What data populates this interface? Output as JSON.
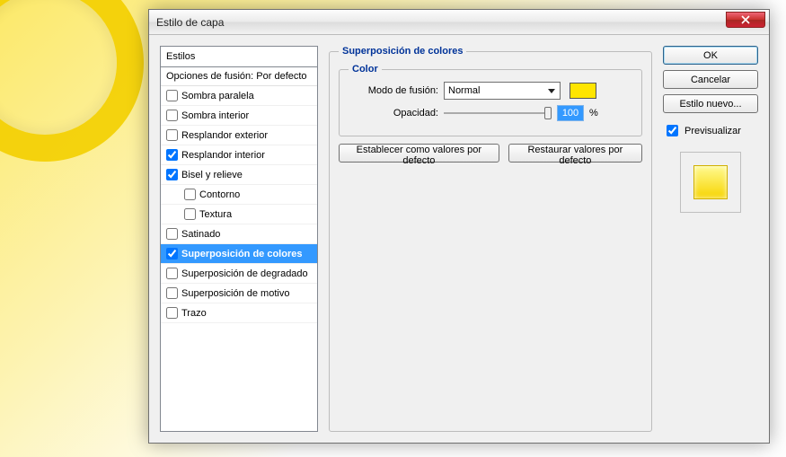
{
  "dialog": {
    "title": "Estilo de capa"
  },
  "styles_panel": {
    "header": "Estilos",
    "blend_options": "Opciones de fusión: Por defecto",
    "items": [
      {
        "label": "Sombra paralela",
        "checked": false,
        "indent": false
      },
      {
        "label": "Sombra interior",
        "checked": false,
        "indent": false
      },
      {
        "label": "Resplandor exterior",
        "checked": false,
        "indent": false
      },
      {
        "label": "Resplandor interior",
        "checked": true,
        "indent": false
      },
      {
        "label": "Bisel y relieve",
        "checked": true,
        "indent": false
      },
      {
        "label": "Contorno",
        "checked": false,
        "indent": true
      },
      {
        "label": "Textura",
        "checked": false,
        "indent": true
      },
      {
        "label": "Satinado",
        "checked": false,
        "indent": false
      },
      {
        "label": "Superposición de colores",
        "checked": true,
        "indent": false,
        "selected": true
      },
      {
        "label": "Superposición de degradado",
        "checked": false,
        "indent": false
      },
      {
        "label": "Superposición de motivo",
        "checked": false,
        "indent": false
      },
      {
        "label": "Trazo",
        "checked": false,
        "indent": false
      }
    ]
  },
  "main": {
    "outer_legend": "Superposición de colores",
    "inner_legend": "Color",
    "blend_mode_label": "Modo de fusión:",
    "blend_mode_value": "Normal",
    "opacity_label": "Opacidad:",
    "opacity_value": "100",
    "opacity_unit": "%",
    "color_swatch": "#ffe500",
    "make_default": "Establecer como valores por defecto",
    "reset_default": "Restaurar valores por defecto"
  },
  "side": {
    "ok": "OK",
    "cancel": "Cancelar",
    "new_style": "Estilo nuevo...",
    "preview": "Previsualizar"
  }
}
